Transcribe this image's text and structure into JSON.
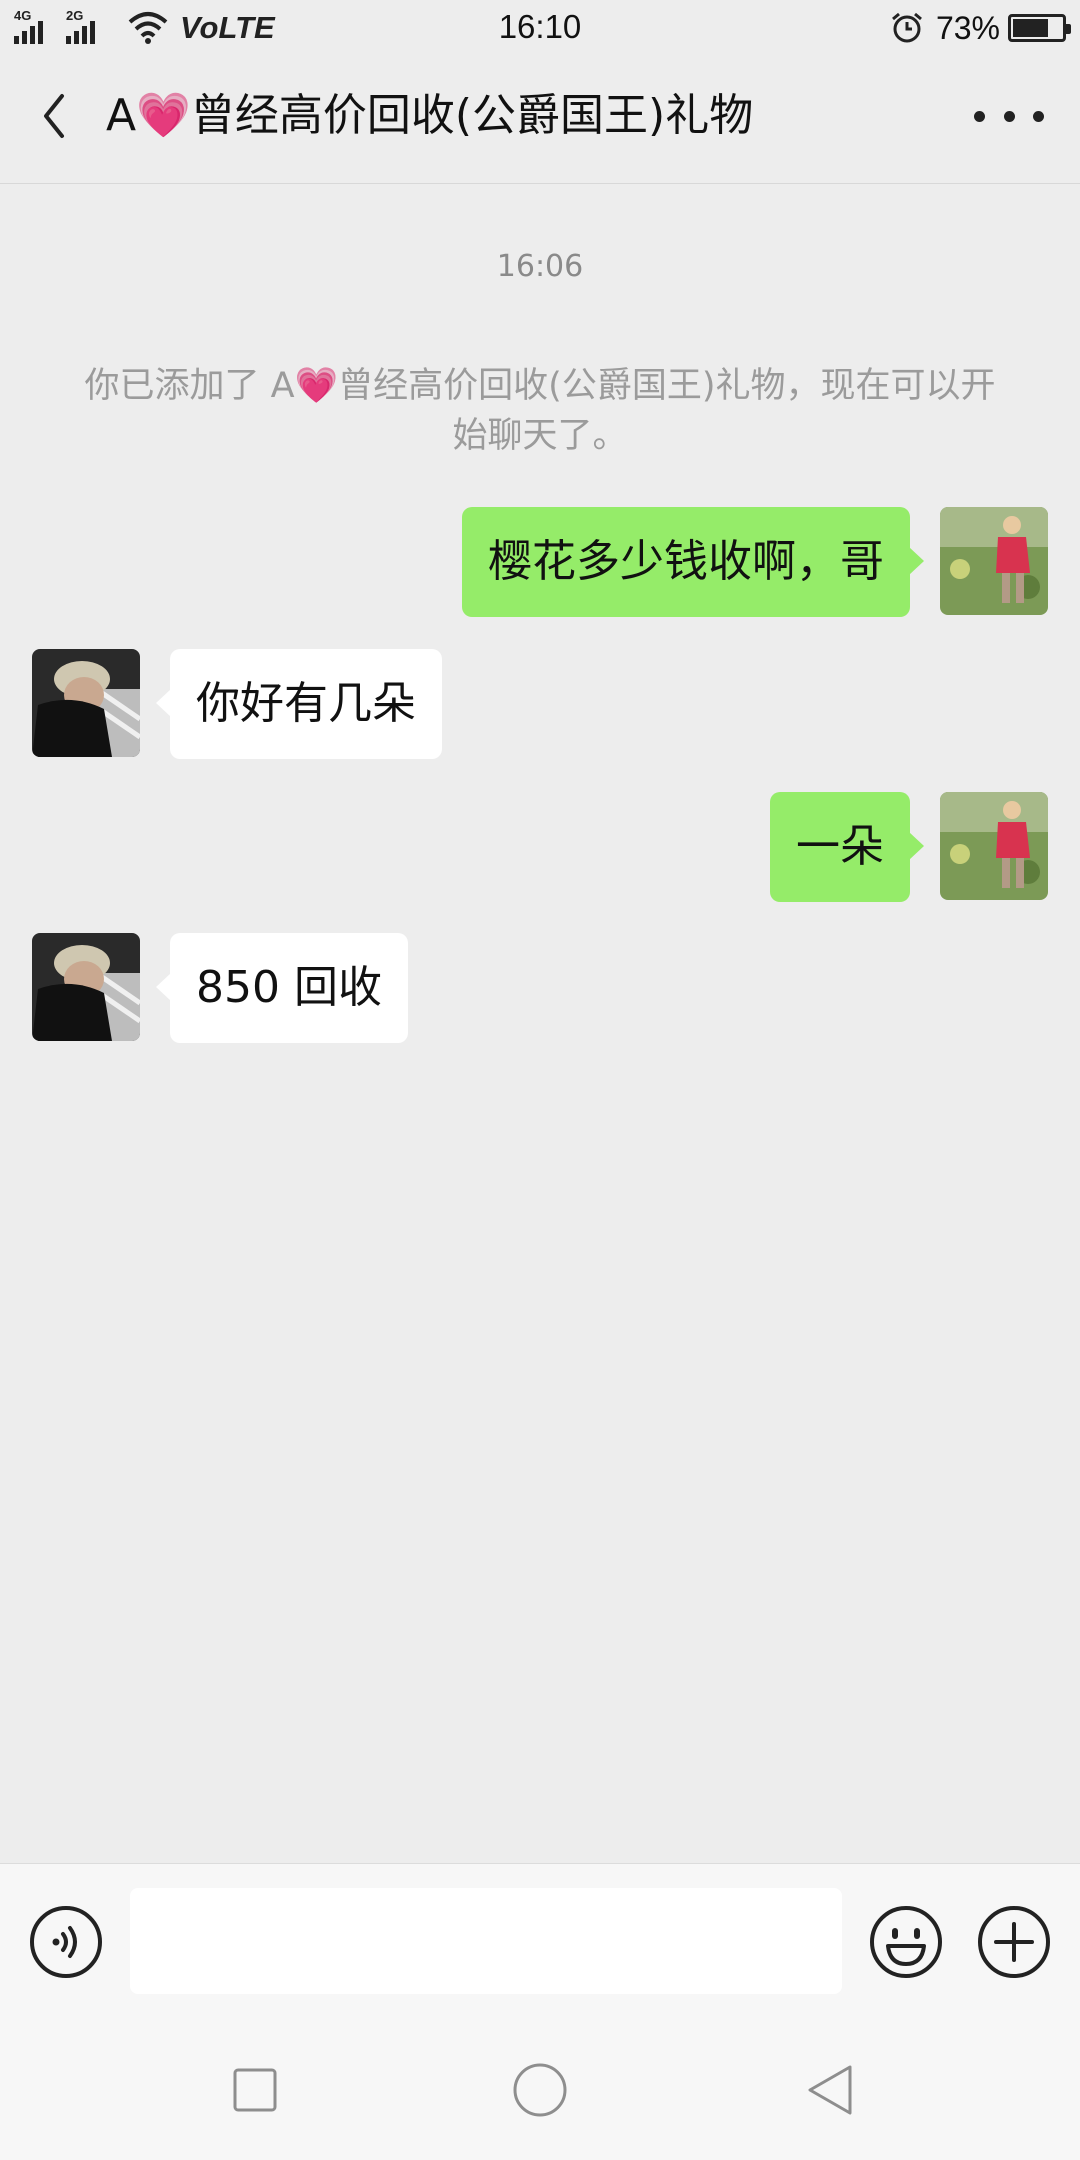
{
  "status_bar": {
    "net1": "4G",
    "net2": "2G",
    "carrier": "VoLTE",
    "time": "16:10",
    "battery_pct": "73%",
    "battery_level": 0.73
  },
  "header": {
    "title": "A💗曾经高价回收(公爵国王)礼物"
  },
  "chat": {
    "timestamp": "16:06",
    "system_notice": "你已添加了 A💗曾经高价回收(公爵国王)礼物，现在可以开始聊天了。",
    "messages": [
      {
        "from": "me",
        "text": "樱花多少钱收啊，哥"
      },
      {
        "from": "them",
        "text": "你好有几朵"
      },
      {
        "from": "me",
        "text": "一朵"
      },
      {
        "from": "them",
        "text": "850 回收"
      }
    ]
  },
  "input": {
    "placeholder": ""
  },
  "colors": {
    "background": "#ededed",
    "my_bubble": "#95ec69",
    "their_bubble": "#ffffff",
    "system_text": "#9b9b9b"
  },
  "icons": {
    "back": "chevron-left-icon",
    "more": "more-dots-icon",
    "voice": "voice-icon",
    "emoji": "emoji-icon",
    "plus": "plus-icon"
  }
}
